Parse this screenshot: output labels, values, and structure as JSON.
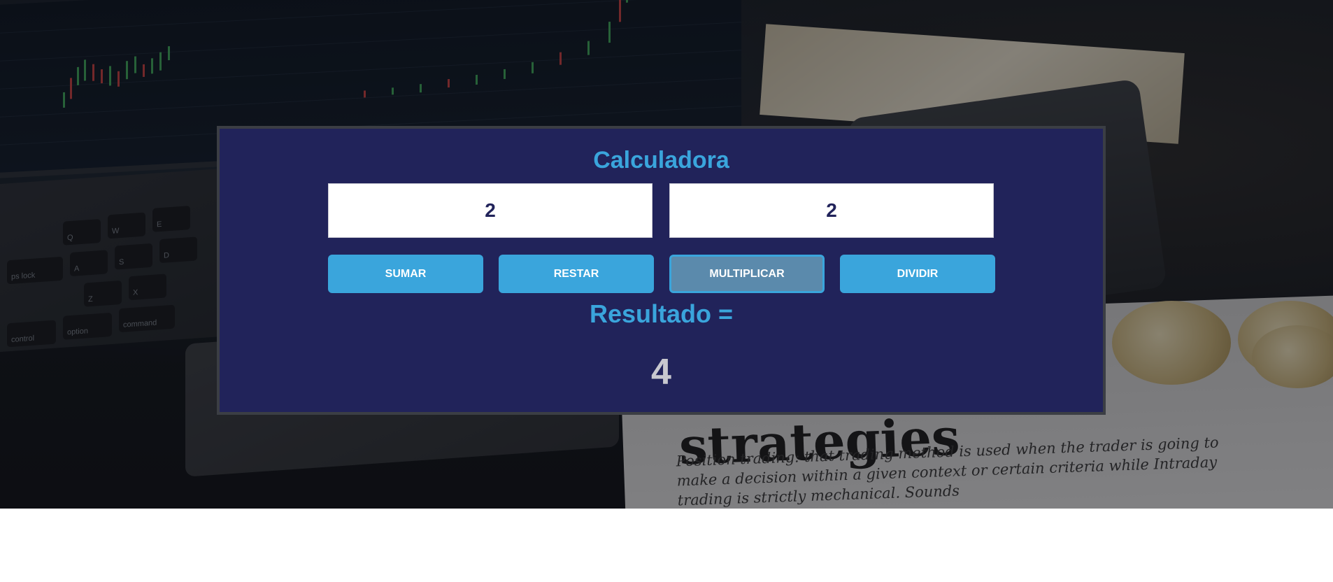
{
  "calculator": {
    "title": "Calculadora",
    "input_a": {
      "value": "2"
    },
    "input_b": {
      "value": "2"
    },
    "buttons": {
      "add": "SUMAR",
      "subtract": "RESTAR",
      "multiply": "MULTIPLICAR",
      "divide": "DIVIDIR"
    },
    "active_operation": "multiply",
    "result_label": "Resultado =",
    "result_value": "4"
  },
  "background": {
    "paper_heading": "strategies",
    "paper_text": "Position trading: that trading method is used when the trader is going to make a decision within a given context or certain criteria while Intraday trading is strictly mechanical. Sounds",
    "keys": [
      "control",
      "option",
      "command",
      "Q",
      "W",
      "E",
      "A",
      "S",
      "D",
      "Z",
      "X",
      "ps lock"
    ]
  },
  "colors": {
    "panel_bg": "#21235a",
    "accent": "#3aa5dc",
    "active_button": "#5b8aac",
    "result_text": "#c8c8cf"
  }
}
